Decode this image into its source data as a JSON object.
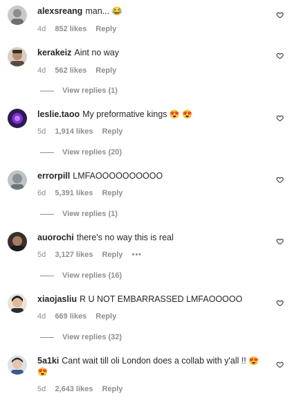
{
  "comments": [
    {
      "user": "alexsreang",
      "text": "man...",
      "emoji": "😂",
      "time": "4d",
      "likes": "852 likes",
      "reply": "Reply",
      "replies": ""
    },
    {
      "user": "kerakeiz",
      "text": "Aint no way",
      "emoji": "",
      "time": "4d",
      "likes": "562 likes",
      "reply": "Reply",
      "replies": "View replies (1)"
    },
    {
      "user": "leslie.taoo",
      "text": "My preformative kings",
      "emoji": "😍 😍",
      "time": "5d",
      "likes": "1,914 likes",
      "reply": "Reply",
      "replies": "View replies (20)"
    },
    {
      "user": "errorpill",
      "text": "LMFAOOOOOOOOOO",
      "emoji": "",
      "time": "6d",
      "likes": "5,391 likes",
      "reply": "Reply",
      "replies": "View replies (1)"
    },
    {
      "user": "auorochi",
      "text": "there's no way this is real",
      "emoji": "",
      "time": "5d",
      "likes": "3,127 likes",
      "reply": "Reply",
      "more": "•••",
      "replies": "View replies (16)"
    },
    {
      "user": "xiaojasliu",
      "text": "R U NOT EMBARRASSED LMFAOOOOO",
      "emoji": "",
      "time": "4d",
      "likes": "669 likes",
      "reply": "Reply",
      "replies": "View replies (32)"
    },
    {
      "user": "5a1ki",
      "text": "Cant wait till oli London does a collab with y'all !!",
      "emoji": "😍 😍",
      "time": "5d",
      "likes": "2,643 likes",
      "reply": "Reply",
      "replies": ""
    }
  ],
  "icons": {
    "heart": "heart-outline-icon",
    "more": "more-dots-icon"
  }
}
